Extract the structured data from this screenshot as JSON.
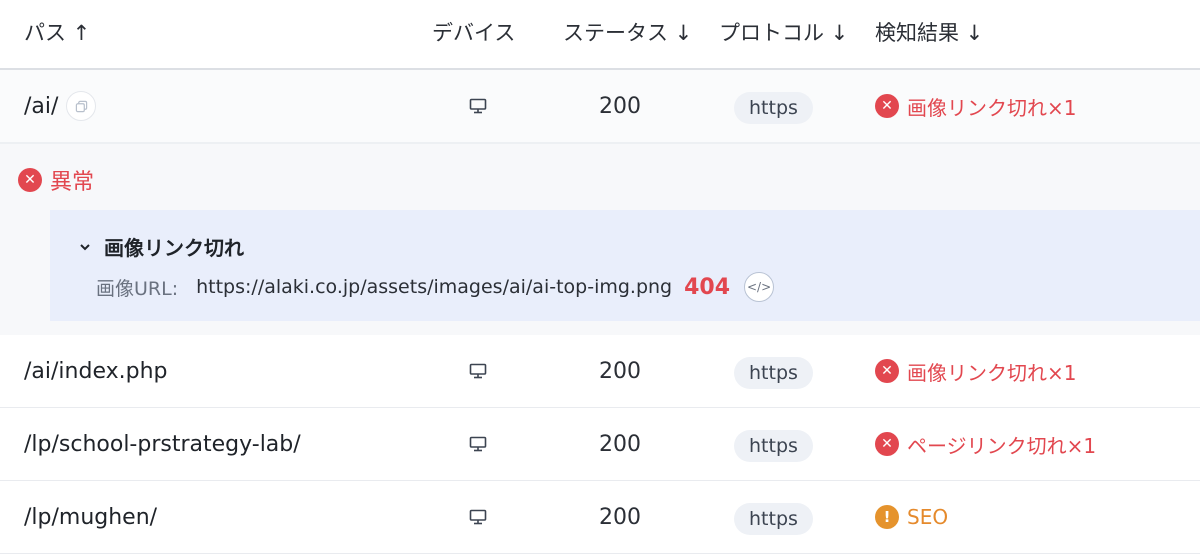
{
  "table": {
    "headers": {
      "path": "パス ↑",
      "device": "デバイス",
      "status": "ステータス ↓",
      "protocol": "プロトコル ↓",
      "result": "検知結果 ↓"
    },
    "rows": [
      {
        "path": "/ai/",
        "device": "desktop-icon",
        "status": "200",
        "protocol": "https",
        "result": "画像リンク切れ×1",
        "result_type": "error"
      },
      {
        "path": "/ai/index.php",
        "device": "desktop-icon",
        "status": "200",
        "protocol": "https",
        "result": "画像リンク切れ×1",
        "result_type": "error"
      },
      {
        "path": "/lp/school-prstrategy-lab/",
        "device": "desktop-icon",
        "status": "200",
        "protocol": "https",
        "result": "ページリンク切れ×1",
        "result_type": "error"
      },
      {
        "path": "/lp/mughen/",
        "device": "desktop-icon",
        "status": "200",
        "protocol": "https",
        "result": "SEO",
        "result_type": "warning"
      }
    ]
  },
  "detail": {
    "abnormal_label": "異常",
    "issue_title": "画像リンク切れ",
    "url_label": "画像URL:",
    "url_value": "https://alaki.co.jp/assets/images/ai/ai-top-img.png",
    "code": "404",
    "code_icon": "</>"
  },
  "icons": {
    "error": "✕",
    "warning": "!"
  },
  "colors": {
    "error": "#e2474f",
    "warning": "#e5932d",
    "detail_bg": "#f7f8fa",
    "issue_bg": "#e9eefb",
    "pill_bg": "#eef1f6"
  }
}
